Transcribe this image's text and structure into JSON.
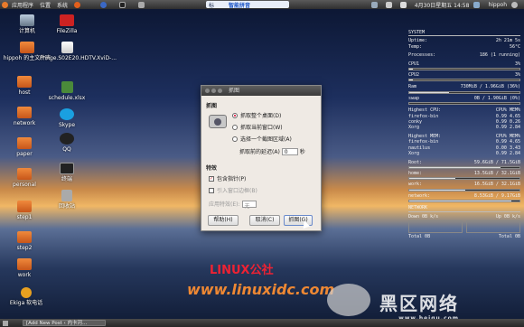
{
  "topbar": {
    "menus": [
      "应用程序",
      "位置",
      "系统"
    ],
    "ime_label": "标",
    "ime_brand": "智能拼音",
    "datetime": "4月30日星期五 14:58",
    "user": "hippoh"
  },
  "desktop_icons": [
    {
      "label": "计算机"
    },
    {
      "label": "FileZilla"
    },
    {
      "label": "hippoh 的主文件夹"
    },
    {
      "label": "Fringe.S02E20.HDTV.XviD-..."
    },
    {
      "label": "host"
    },
    {
      "label": "schedule.xlsx"
    },
    {
      "label": "network"
    },
    {
      "label": "Skype"
    },
    {
      "label": "QQ"
    },
    {
      "label": "paper"
    },
    {
      "label": "终端"
    },
    {
      "label": "personal"
    },
    {
      "label": "回收站"
    },
    {
      "label": "step1"
    },
    {
      "label": "step2"
    },
    {
      "label": "work"
    },
    {
      "label": "Ekiga 软电话"
    }
  ],
  "conky": {
    "system_label": "SYSTEM",
    "uptime_label": "Uptime:",
    "uptime": "2h 21m 5s",
    "temp_label": "Temp:",
    "temp": "56°C",
    "processes_label": "Processes:",
    "processes": "186 (1 running)",
    "cpu1_label": "CPU1",
    "cpu1": "3%",
    "cpu1_fill": 0.03,
    "cpu2_label": "CPU2",
    "cpu2": "3%",
    "cpu2_fill": 0.03,
    "ram_label": "Ram",
    "ram": "730MiB / 1.96GiB (36%)",
    "ram_fill": 0.36,
    "swap_label": "swap",
    "swap": "0B / 1.90GiB (0%)",
    "swap_fill": 0.0,
    "highest_cpu_label": "Highest CPU:",
    "cpu_mem_label": "CPU% MEM%",
    "cpu_procs": [
      {
        "name": "firefox-bin",
        "val": "0.99 4.65"
      },
      {
        "name": "conky",
        "val": "0.99 0.26"
      },
      {
        "name": "Xorg",
        "val": "0.99 2.84"
      }
    ],
    "highest_mem_label": "Highest MEM:",
    "mem_procs": [
      {
        "name": "firefox-bin",
        "val": "0.99 4.65"
      },
      {
        "name": "nautilus",
        "val": "0.00 3.43"
      },
      {
        "name": "Xorg",
        "val": "0.99 2.84"
      }
    ],
    "root_label": "Root:",
    "root": "59.6GiB / 71.5GiB",
    "root_fill": 0.83,
    "home_label": "home:",
    "home": "13.5GiB / 32.1GiB",
    "home_fill": 0.42,
    "work_label": "work:",
    "work": "16.5GiB / 32.1GiB",
    "work_fill": 0.51,
    "network_label": "network:",
    "network": "8.53GiB / 9.17GiB",
    "network_fill": 0.93,
    "net_header": "NETWORK",
    "down_label": "Down 0B  k/s",
    "up_label": "Up 0B  k/s",
    "total_down": "Total 0B",
    "total_up": "Total 0B"
  },
  "dialog": {
    "title": "抓图",
    "grab_section": "抓图",
    "opt_desktop": "抓取整个桌面(D)",
    "opt_window": "抓取当前窗口(W)",
    "opt_area": "选择一个截图区域(A)",
    "delay_label": "抓取前的延迟(A)",
    "delay_value": "0",
    "delay_unit": "秒",
    "effects_section": "特效",
    "include_pointer": "包含指针(P)",
    "include_border": "引入窗口边框(B)",
    "apply_effect_label": "应用特效(E):",
    "effect_value": "无",
    "help_btn": "帮助(H)",
    "cancel_btn": "取消(C)",
    "grab_btn": "抓图(G)"
  },
  "taskbar": {
    "task": "[Add New Post ‹ 内卡河..."
  },
  "watermarks": {
    "linux_logo": "LINUX公社",
    "linux_url": "www.linuxidc.com",
    "heiqu": "黑区网络",
    "heiqu_url": "www.heiqu.com"
  }
}
